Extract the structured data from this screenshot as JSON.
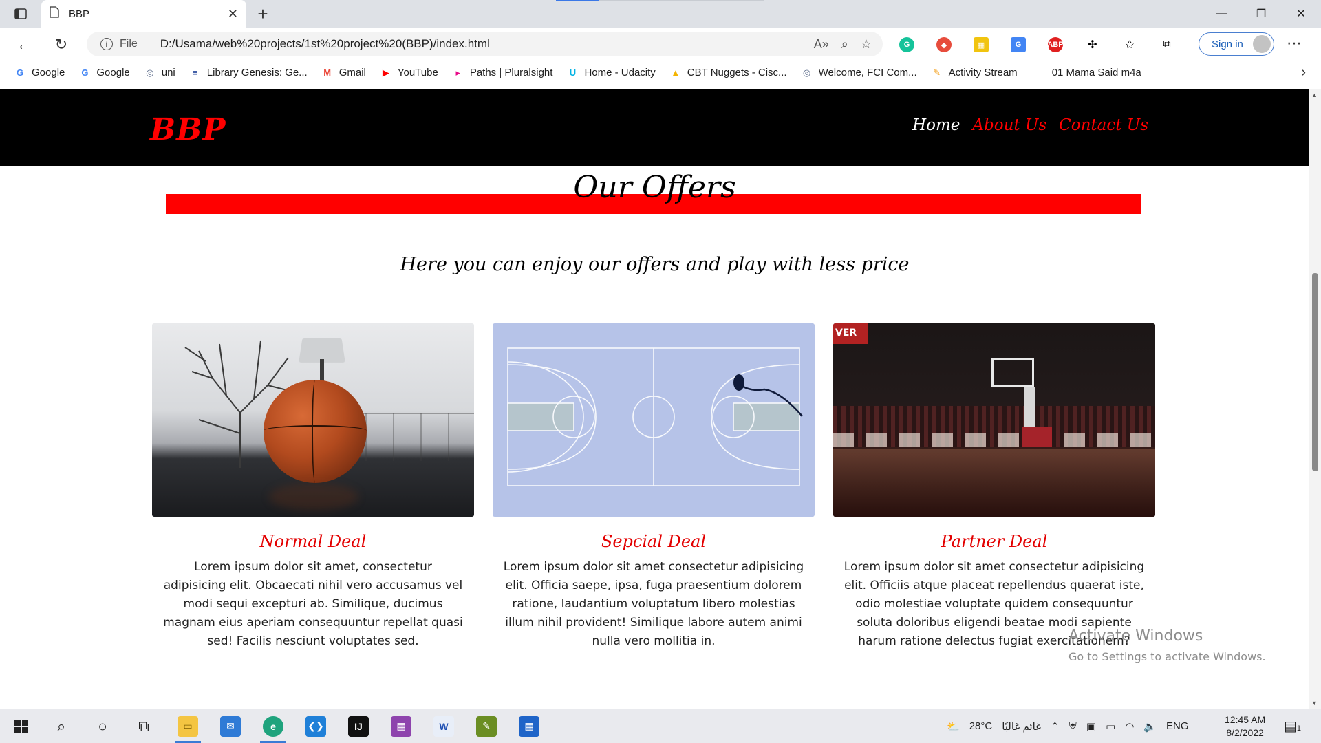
{
  "browser": {
    "tab_title": "BBP",
    "new_tab_label": "+",
    "address_info": "File",
    "url": "D:/Usama/web%20projects/1st%20project%20(BBP)/index.html",
    "sign_in": "Sign in",
    "bookmarks": [
      {
        "label": "Google",
        "icon": "google-icon",
        "color": "#4285f4",
        "glyph": "G"
      },
      {
        "label": "Google",
        "icon": "google-icon",
        "color": "#4285f4",
        "glyph": "G"
      },
      {
        "label": "uni",
        "icon": "uni-icon",
        "color": "#5b6b8a",
        "glyph": "◎"
      },
      {
        "label": "Library Genesis: Ge...",
        "icon": "library-icon",
        "color": "#2b4a9c",
        "glyph": "≡"
      },
      {
        "label": "Gmail",
        "icon": "gmail-icon",
        "color": "#ea4335",
        "glyph": "M"
      },
      {
        "label": "YouTube",
        "icon": "youtube-icon",
        "color": "#ff0000",
        "glyph": "▶"
      },
      {
        "label": "Paths | Pluralsight",
        "icon": "pluralsight-icon",
        "color": "#e80a89",
        "glyph": "▸"
      },
      {
        "label": "Home - Udacity",
        "icon": "udacity-icon",
        "color": "#02b3e4",
        "glyph": "U"
      },
      {
        "label": "CBT Nuggets - Cisc...",
        "icon": "drive-icon",
        "color": "#f4b400",
        "glyph": "▲"
      },
      {
        "label": "Welcome, FCI Com...",
        "icon": "fci-icon",
        "color": "#5b6b8a",
        "glyph": "◎"
      },
      {
        "label": "Activity Stream",
        "icon": "activity-icon",
        "color": "#f39c12",
        "glyph": "✎"
      },
      {
        "label": "01 Mama Said m4a",
        "icon": "",
        "color": "",
        "glyph": ""
      }
    ]
  },
  "site": {
    "logo": "BBP",
    "nav": {
      "home": "Home",
      "about": "About Us",
      "contact": "Contact Us"
    },
    "section_title": "Our Offers",
    "section_subtitle": "Here you can enjoy our offers and play with less price",
    "cards": [
      {
        "title": "Normal Deal",
        "text": "Lorem ipsum dolor sit amet, consectetur adipisicing elit. Obcaecati nihil vero accusamus vel modi sequi excepturi ab. Similique, ducimus magnam eius aperiam consequuntur repellat quasi sed! Facilis nesciunt voluptates sed."
      },
      {
        "title": "Sepcial Deal",
        "text": "Lorem ipsum dolor sit amet consectetur adipisicing elit. Officia saepe, ipsa, fuga praesentium dolorem ratione, laudantium voluptatum libero molestias illum nihil provident! Similique labore autem animi nulla vero mollitia in."
      },
      {
        "title": "Partner Deal",
        "text": "Lorem ipsum dolor sit amet consectetur adipisicing elit. Officiis atque placeat repellendus quaerat iste, odio molestiae voluptate quidem consequuntur soluta doloribus eligendi beatae modi sapiente harum ratione delectus fugiat exercitationem?"
      }
    ],
    "photo3_banner": "VER"
  },
  "watermark": {
    "line1": "Activate Windows",
    "line2": "Go to Settings to activate Windows."
  },
  "taskbar": {
    "weather": "28°C",
    "weather_text": "غائم غالبًا",
    "language": "ENG",
    "time": "12:45 AM",
    "date": "8/2/2022",
    "notifications": "1"
  },
  "colors": {
    "accent_red": "#ff0000",
    "nav_bg": "#000000",
    "deal_title": "#e30000"
  }
}
